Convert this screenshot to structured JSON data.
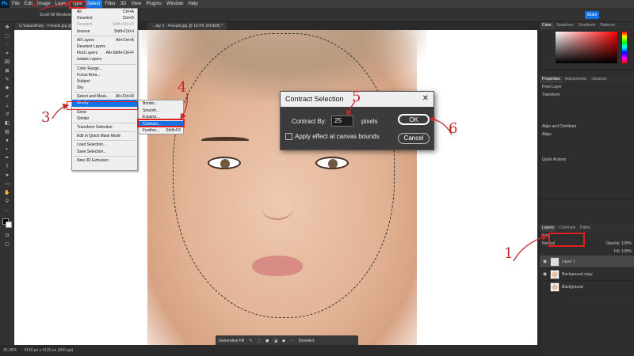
{
  "menubar": {
    "logo": "Ps",
    "items": [
      "File",
      "Edit",
      "Image",
      "Layer",
      "Type",
      "Select",
      "Filter",
      "3D",
      "View",
      "Plugins",
      "Window",
      "Help"
    ],
    "active": "Select"
  },
  "options": {
    "share_label": "Share",
    "scroll_all": "Scroll All Windows"
  },
  "tabs": [
    "U ValuestKaty - Freepik.jpg @ 1...",
    "...aly 3 - Freepik.jpg @ 18.4% (RGB/8) *"
  ],
  "select_menu": {
    "items": [
      {
        "label": "All",
        "shortcut": "Ctrl+A"
      },
      {
        "label": "Deselect",
        "shortcut": "Ctrl+D"
      },
      {
        "label": "Reselect",
        "shortcut": "Shift+Ctrl+D",
        "dim": true
      },
      {
        "label": "Inverse",
        "shortcut": "Shift+Ctrl+I"
      },
      {
        "sep": true
      },
      {
        "label": "All Layers",
        "shortcut": "Alt+Ctrl+A"
      },
      {
        "label": "Deselect Layers",
        "shortcut": ""
      },
      {
        "label": "Find Layers",
        "shortcut": "Alt+Shift+Ctrl+F"
      },
      {
        "label": "Isolate Layers",
        "shortcut": ""
      },
      {
        "sep": true
      },
      {
        "label": "Color Range...",
        "shortcut": ""
      },
      {
        "label": "Focus Area...",
        "shortcut": ""
      },
      {
        "label": "Subject",
        "shortcut": ""
      },
      {
        "label": "Sky",
        "shortcut": ""
      },
      {
        "sep": true
      },
      {
        "label": "Select and Mask...",
        "shortcut": "Alt+Ctrl+R"
      },
      {
        "label": "Modify",
        "shortcut": "",
        "highlight": true
      },
      {
        "sep": true
      },
      {
        "label": "Grow",
        "shortcut": ""
      },
      {
        "label": "Similar",
        "shortcut": ""
      },
      {
        "sep": true
      },
      {
        "label": "Transform Selection",
        "shortcut": ""
      },
      {
        "sep": true
      },
      {
        "label": "Edit in Quick Mask Mode",
        "shortcut": ""
      },
      {
        "sep": true
      },
      {
        "label": "Load Selection...",
        "shortcut": ""
      },
      {
        "label": "Save Selection...",
        "shortcut": ""
      },
      {
        "sep": true
      },
      {
        "label": "New 3D Extrusion",
        "shortcut": ""
      }
    ]
  },
  "modify_submenu": {
    "items": [
      {
        "label": "Border...",
        "shortcut": ""
      },
      {
        "label": "Smooth...",
        "shortcut": ""
      },
      {
        "label": "Expand...",
        "shortcut": ""
      },
      {
        "label": "Contract...",
        "shortcut": "",
        "highlight": true
      },
      {
        "label": "Feather...",
        "shortcut": "Shift+F6"
      }
    ]
  },
  "dialog": {
    "title": "Contract Selection",
    "close": "✕",
    "contract_label": "Contract By:",
    "contract_value": "25",
    "units": "pixels",
    "checkbox_label": "Apply effect at canvas bounds",
    "ok": "OK",
    "cancel": "Cancel"
  },
  "annotations": {
    "n1": "1",
    "n2": "2",
    "n3": "3",
    "n4": "4",
    "n5": "5",
    "n6": "6"
  },
  "panel": {
    "color_tabs": [
      "Color",
      "Swatches",
      "Gradients",
      "Patterns"
    ],
    "prop_tabs": [
      "Properties",
      "Adjustments",
      "Libraries"
    ],
    "pixel_layer": "Pixel Layer",
    "transform": "Transform",
    "align": "Align and Distribute",
    "align_sub": "Align:",
    "quick_actions": "Quick Actions",
    "layer_tabs": [
      "Layers",
      "Channels",
      "Paths"
    ],
    "blend_mode": "Normal",
    "opacity": "Opacity: 100%",
    "fill": "Fill: 100%",
    "kind": "Kind",
    "layers": [
      {
        "name": "Layer 1",
        "selected": true
      },
      {
        "name": "Background copy",
        "selected": false
      },
      {
        "name": "Background",
        "selected": false
      }
    ]
  },
  "canvas_taskbar": {
    "generative_fill": "Generative Fill",
    "deselect": "Deselect"
  },
  "status": {
    "zoom": "25.36%",
    "doc_size": "4160 px x 3120 px (300 ppi)"
  }
}
